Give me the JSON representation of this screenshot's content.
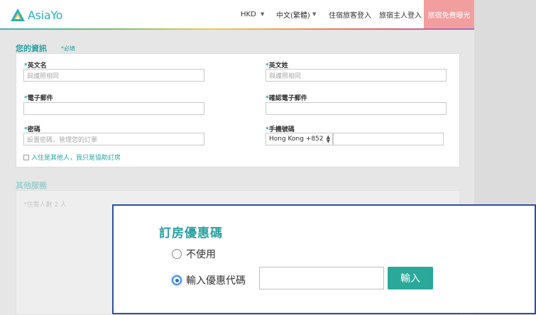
{
  "header": {
    "logo_text": "AsiaYo",
    "currency": "HKD",
    "language": "中文(繁體)",
    "guest_login": "住宿旅客登入",
    "host_login": "旅宿主人登入",
    "host_cta": "旅宿免費曝光"
  },
  "your_info": {
    "title": "您的資訊",
    "required_note": "*必填",
    "first_name": {
      "label": "英文名",
      "placeholder": "與護照相同"
    },
    "last_name": {
      "label": "英文姓",
      "placeholder": "與護照相同"
    },
    "email": {
      "label": "電子郵件",
      "placeholder": ""
    },
    "confirm_email": {
      "label": "確認電子郵件",
      "placeholder": ""
    },
    "password": {
      "label": "密碼",
      "placeholder": "設置密碼，管理您的訂單"
    },
    "phone": {
      "label": "手機號碼",
      "country_code": "Hong Kong +852",
      "placeholder": ""
    },
    "checkbox_label": "入住是其他人，我只是協助訂房"
  },
  "other_services": {
    "title": "其他服務",
    "guests": "*住客人數 2 人"
  },
  "coupon": {
    "title": "訂房優惠碼",
    "option_none": "不使用",
    "option_enter": "輸入優惠代碼",
    "code_value": "",
    "submit_label": "輸入"
  },
  "colors": {
    "brand_teal": "#2aa1a1",
    "host_cta": "#f29e9e",
    "button_teal": "#2aa89a",
    "overlay_border": "#2e4fa0"
  }
}
